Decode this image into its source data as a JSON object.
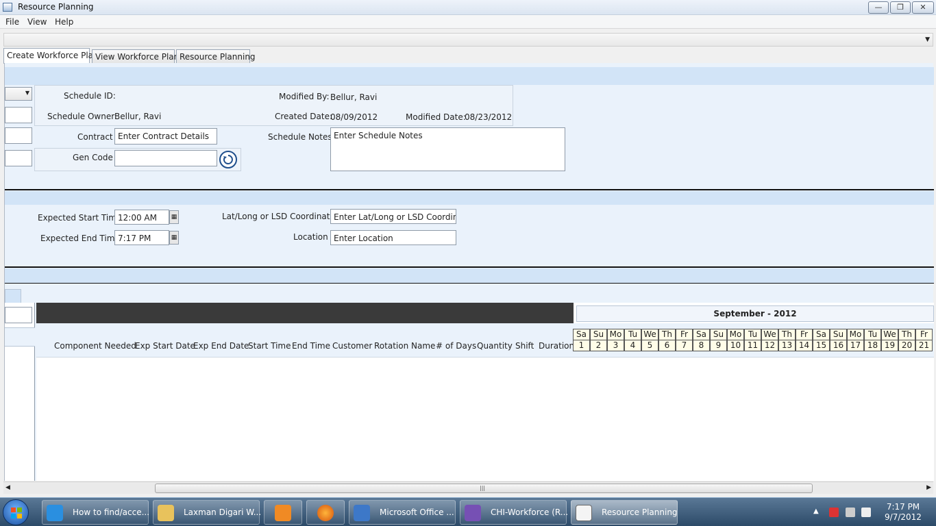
{
  "window": {
    "title": "Resource Planning",
    "min_glyph": "—",
    "max_glyph": "❐",
    "close_glyph": "✕"
  },
  "menu": [
    "File",
    "View",
    "Help"
  ],
  "tabs": [
    "Create Workforce Plan",
    "View Workforce Plan",
    "Resource Planning"
  ],
  "schedule": {
    "id_label": "Schedule ID:",
    "id_value": "",
    "owner_label": "Schedule Owner:",
    "owner_value": "Bellur, Ravi",
    "modified_by_label": "Modified By:",
    "modified_by_value": "Bellur, Ravi",
    "created_date_label": "Created Date:",
    "created_date_value": "08/09/2012",
    "modified_date_label": "Modified Date:",
    "modified_date_value": "08/23/2012",
    "contract_label": "Contract",
    "contract_value": "Enter Contract Details",
    "gen_code_label": "Gen Code",
    "gen_code_value": "",
    "notes_label": "Schedule Notes",
    "notes_value": "Enter Schedule Notes"
  },
  "timing": {
    "start_label": "Expected Start Time",
    "start_value": "12:00 AM",
    "end_label": "Expected End Time",
    "end_value": "7:17 PM",
    "coords_label": "Lat/Long or LSD Coordinates",
    "coords_value": "Enter Lat/Long or LSD Coordinate",
    "location_label": "Location",
    "location_value": "Enter Location"
  },
  "grid": {
    "month": "September - 2012",
    "columns": [
      "Component Needed",
      "Exp Start Date",
      "Exp End Date",
      "Start Time",
      "End Time",
      "Customer",
      "Rotation Name",
      "# of Days",
      "Quantity",
      "Shift",
      "Duration"
    ],
    "day_names": [
      "Sa",
      "Su",
      "Mo",
      "Tu",
      "We",
      "Th",
      "Fr",
      "Sa",
      "Su",
      "Mo",
      "Tu",
      "We",
      "Th",
      "Fr",
      "Sa",
      "Su",
      "Mo",
      "Tu",
      "We",
      "Th",
      "Fr"
    ],
    "day_numbers": [
      "1",
      "2",
      "3",
      "4",
      "5",
      "6",
      "7",
      "8",
      "9",
      "10",
      "11",
      "12",
      "13",
      "14",
      "15",
      "16",
      "17",
      "18",
      "19",
      "20",
      "21"
    ]
  },
  "taskbar": {
    "items": [
      "How to find/acce...",
      "Laxman Digari W...",
      "",
      "",
      "Microsoft Office ...",
      "CHI-Workforce (R...",
      "Resource Planning"
    ],
    "time": "7:17 PM",
    "date": "9/7/2012"
  }
}
